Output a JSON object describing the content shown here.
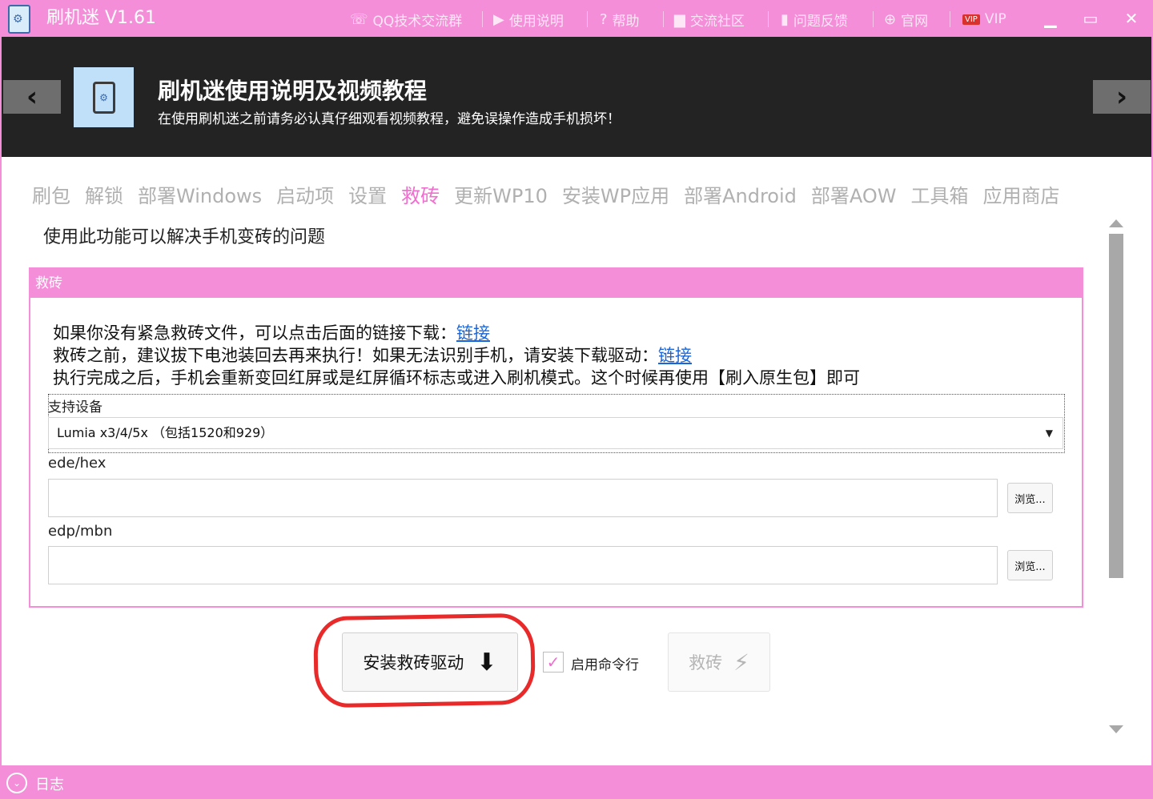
{
  "app": {
    "title": "刷机迷 V1.61"
  },
  "titlebar": {
    "items": [
      {
        "label": "QQ技术交流群",
        "icon": "qq-group-icon"
      },
      {
        "label": "使用说明",
        "icon": "video-icon"
      },
      {
        "label": "帮助",
        "icon": "help-icon"
      },
      {
        "label": "交流社区",
        "icon": "chat-icon"
      },
      {
        "label": "问题反馈",
        "icon": "feedback-icon"
      },
      {
        "label": "官网",
        "icon": "globe-icon"
      },
      {
        "label": "VIP",
        "icon": "vip-icon"
      }
    ],
    "vip_badge": "VIP"
  },
  "banner": {
    "title": "刷机迷使用说明及视频教程",
    "subtitle": "在使用刷机迷之前请务必认真仔细观看视频教程，避免误操作造成手机损坏！"
  },
  "tabs": [
    "刷包",
    "解锁",
    "部署Windows",
    "启动项",
    "设置",
    "救砖",
    "更新WP10",
    "安装WP应用",
    "部署Android",
    "部署AOW",
    "工具箱",
    "应用商店"
  ],
  "active_tab": "救砖",
  "main": {
    "description": "使用此功能可以解决手机变砖的问题",
    "group_title": "救砖",
    "info": {
      "line1": "如果你没有紧急救砖文件，可以点击后面的链接下载：",
      "line1_link": "链接",
      "line2": "救砖之前，建议拔下电池装回去再来执行！如果无法识别手机，请安装下载驱动：",
      "line2_link": "链接",
      "line3": "执行完成之后，手机会重新变回红屏或是红屏循环标志或进入刷机模式。这个时候再使用【刷入原生包】即可"
    },
    "device": {
      "label": "支持设备",
      "selected": "Lumia x3/4/5x （包括1520和929）"
    },
    "ede": {
      "label": "ede/hex",
      "value": "",
      "browse": "浏览..."
    },
    "edp": {
      "label": "edp/mbn",
      "value": "",
      "browse": "浏览..."
    },
    "install_driver_button": "安装救砖驱动",
    "cmd_checkbox": {
      "label": "启用命令行",
      "checked": true
    },
    "rescue_button": "救砖"
  },
  "statusbar": {
    "log_label": "日志"
  },
  "colors": {
    "accent": "#f58ed9",
    "active_tab": "#ef6fcf",
    "link": "#1a66d8",
    "banner_bg": "#232323",
    "annotation": "#e82a2a"
  }
}
